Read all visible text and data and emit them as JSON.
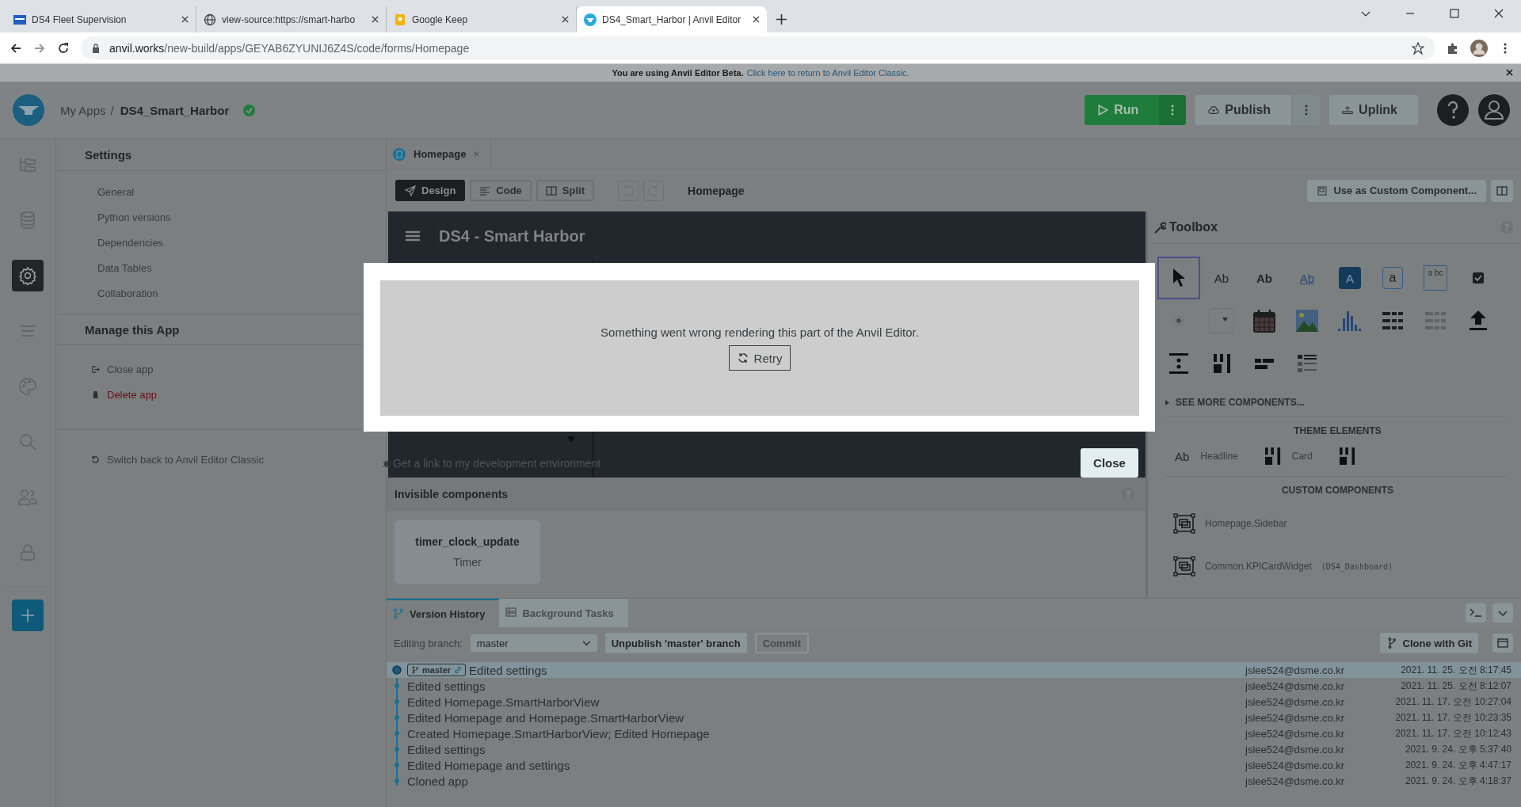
{
  "browser": {
    "tabs": [
      {
        "title": "DS4 Fleet Supervision",
        "selected": false
      },
      {
        "title": "view-source:https://smart-harbo",
        "selected": false
      },
      {
        "title": "Google Keep",
        "selected": false
      },
      {
        "title": "DS4_Smart_Harbor | Anvil Editor",
        "selected": true
      }
    ],
    "url_host": "anvil.works",
    "url_path": "/new-build/apps/GEYAB6ZYUNIJ6Z4S/code/forms/Homepage"
  },
  "banner": {
    "text": "You are using Anvil Editor Beta.",
    "link": "Click here to return to Anvil Editor Classic."
  },
  "header": {
    "root": "My Apps",
    "separator": "/",
    "app_name": "DS4_Smart_Harbor",
    "saved": true,
    "run": "Run",
    "publish": "Publish",
    "uplink": "Uplink"
  },
  "rail": [
    {
      "selected": false
    },
    {
      "selected": false
    },
    {
      "selected": true
    },
    {
      "selected": false
    },
    {
      "selected": false
    },
    {
      "selected": false
    },
    {
      "selected": false
    },
    {
      "selected": false
    }
  ],
  "settings": {
    "title": "Settings",
    "items": [
      "General",
      "Python versions",
      "Dependencies",
      "Data Tables",
      "Collaboration"
    ],
    "manage_title": "Manage this App",
    "manage_items": [
      {
        "label": "Close app",
        "kind": "close"
      },
      {
        "label": "Delete app",
        "kind": "delete"
      }
    ],
    "switch_link": "Switch back to Anvil Editor Classic"
  },
  "editor": {
    "file_tab": "Homepage",
    "modes": [
      {
        "label": "Design",
        "selected": true
      },
      {
        "label": "Code",
        "selected": false
      },
      {
        "label": "Split",
        "selected": false
      }
    ],
    "form_name": "Homepage",
    "custom_button": "Use as Custom Component...",
    "app_title": "DS4 - Smart Harbor",
    "dev_link": "Get a link to my development environment",
    "invisible_title": "Invisible components",
    "invisible": [
      {
        "name": "timer_clock_update",
        "type": "Timer"
      }
    ]
  },
  "modal": {
    "message": "Something went wrong rendering this part of the Anvil Editor.",
    "retry": "Retry",
    "close": "Close"
  },
  "toolbox": {
    "title": "Toolbox",
    "tools": [
      {
        "kind": "pointer",
        "selected": true
      },
      {
        "kind": "label",
        "text": "Ab",
        "selected": false
      },
      {
        "kind": "bold",
        "text": "Ab",
        "selected": false
      },
      {
        "kind": "link",
        "text": "Ab",
        "selected": false
      },
      {
        "kind": "button",
        "text": "A",
        "selected": false
      },
      {
        "kind": "textbox",
        "text": "a",
        "selected": false
      },
      {
        "kind": "textarea",
        "text": "a bc",
        "selected": false
      },
      {
        "kind": "checkbox",
        "selected": false
      },
      {
        "kind": "radio",
        "selected": false
      },
      {
        "kind": "dropdown",
        "selected": false
      },
      {
        "kind": "calendar",
        "selected": false
      },
      {
        "kind": "image",
        "selected": false
      },
      {
        "kind": "chart",
        "selected": false
      },
      {
        "kind": "grid",
        "selected": false
      },
      {
        "kind": "grid-light",
        "selected": false
      },
      {
        "kind": "upload",
        "selected": false
      },
      {
        "kind": "spacer",
        "selected": false
      },
      {
        "kind": "columns",
        "selected": false
      },
      {
        "kind": "flow",
        "selected": false
      },
      {
        "kind": "rows",
        "selected": false
      }
    ],
    "see_more": "SEE MORE COMPONENTS...",
    "theme_title": "THEME ELEMENTS",
    "theme": [
      {
        "kind": "text",
        "glyph": "Ab",
        "label": "Headline"
      },
      {
        "kind": "columns",
        "label": "Card"
      },
      {
        "kind": "columns"
      }
    ],
    "custom_title": "CUSTOM COMPONENTS",
    "custom": [
      {
        "name": "Homepage.Sidebar"
      },
      {
        "name": "Common.KPICardWidget",
        "package": "(DS4_Dashboard)"
      }
    ]
  },
  "history": {
    "tabs": [
      {
        "label": "Version History",
        "selected": true
      },
      {
        "label": "Background Tasks",
        "selected": false
      }
    ],
    "branch_label": "Editing branch:",
    "branch": "master",
    "unpublish": "Unpublish 'master' branch",
    "commit": "Commit",
    "commit_disabled": true,
    "clone": "Clone with Git",
    "commits": [
      {
        "message": "Edited settings",
        "author": "jslee524@dsme.co.kr",
        "date": "2021. 11. 25. 오전 8:17:45",
        "selected": true,
        "branch": "master"
      },
      {
        "message": "Edited settings",
        "author": "jslee524@dsme.co.kr",
        "date": "2021. 11. 25. 오전 8:12:07",
        "selected": false
      },
      {
        "message": "Edited Homepage.SmartHarborView",
        "author": "jslee524@dsme.co.kr",
        "date": "2021. 11. 17. 오전 10:27:04",
        "selected": false
      },
      {
        "message": "Edited Homepage and Homepage.SmartHarborView",
        "author": "jslee524@dsme.co.kr",
        "date": "2021. 11. 17. 오전 10:23:35",
        "selected": false
      },
      {
        "message": "Created Homepage.SmartHarborView; Edited Homepage",
        "author": "jslee524@dsme.co.kr",
        "date": "2021. 11. 17. 오전 10:12:43",
        "selected": false
      },
      {
        "message": "Edited settings",
        "author": "jslee524@dsme.co.kr",
        "date": "2021. 9. 24. 오후 5:37:40",
        "selected": false
      },
      {
        "message": "Edited Homepage and settings",
        "author": "jslee524@dsme.co.kr",
        "date": "2021. 9. 24. 오후 4:47:17",
        "selected": false
      },
      {
        "message": "Cloned app",
        "author": "jslee524@dsme.co.kr",
        "date": "2021. 9. 24. 오후 4:18:37",
        "selected": false
      }
    ]
  }
}
